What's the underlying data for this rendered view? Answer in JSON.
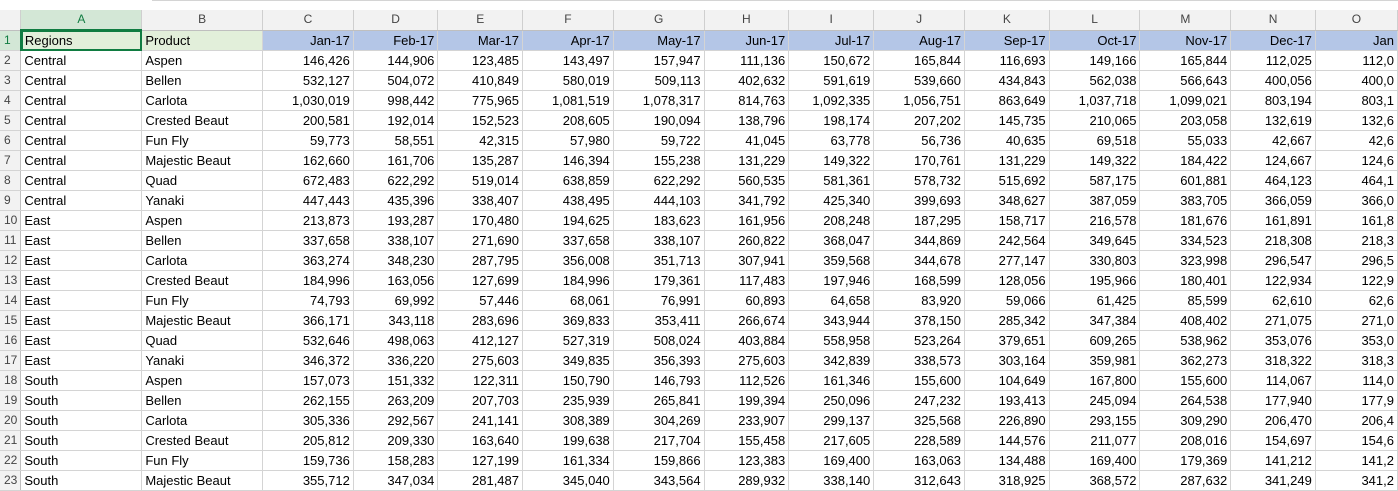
{
  "columns": [
    "A",
    "B",
    "C",
    "D",
    "E",
    "F",
    "G",
    "H",
    "I",
    "J",
    "K",
    "L",
    "M",
    "N",
    "O"
  ],
  "header_row": [
    "Regions",
    "Product",
    "Jan-17",
    "Feb-17",
    "Mar-17",
    "Apr-17",
    "May-17",
    "Jun-17",
    "Jul-17",
    "Aug-17",
    "Sep-17",
    "Oct-17",
    "Nov-17",
    "Dec-17",
    "Jan"
  ],
  "active_cell": "A1",
  "rows": [
    {
      "n": "2",
      "cells": [
        "Central",
        "Aspen",
        "146,426",
        "144,906",
        "123,485",
        "143,497",
        "157,947",
        "111,136",
        "150,672",
        "165,844",
        "116,693",
        "149,166",
        "165,844",
        "112,025",
        "112,0"
      ]
    },
    {
      "n": "3",
      "cells": [
        "Central",
        "Bellen",
        "532,127",
        "504,072",
        "410,849",
        "580,019",
        "509,113",
        "402,632",
        "591,619",
        "539,660",
        "434,843",
        "562,038",
        "566,643",
        "400,056",
        "400,0"
      ]
    },
    {
      "n": "4",
      "cells": [
        "Central",
        "Carlota",
        "1,030,019",
        "998,442",
        "775,965",
        "1,081,519",
        "1,078,317",
        "814,763",
        "1,092,335",
        "1,056,751",
        "863,649",
        "1,037,718",
        "1,099,021",
        "803,194",
        "803,1"
      ]
    },
    {
      "n": "5",
      "cells": [
        "Central",
        "Crested Beaut",
        "200,581",
        "192,014",
        "152,523",
        "208,605",
        "190,094",
        "138,796",
        "198,174",
        "207,202",
        "145,735",
        "210,065",
        "203,058",
        "132,619",
        "132,6"
      ]
    },
    {
      "n": "6",
      "cells": [
        "Central",
        "Fun Fly",
        "59,773",
        "58,551",
        "42,315",
        "57,980",
        "59,722",
        "41,045",
        "63,778",
        "56,736",
        "40,635",
        "69,518",
        "55,033",
        "42,667",
        "42,6"
      ]
    },
    {
      "n": "7",
      "cells": [
        "Central",
        "Majestic Beaut",
        "162,660",
        "161,706",
        "135,287",
        "146,394",
        "155,238",
        "131,229",
        "149,322",
        "170,761",
        "131,229",
        "149,322",
        "184,422",
        "124,667",
        "124,6"
      ]
    },
    {
      "n": "8",
      "cells": [
        "Central",
        "Quad",
        "672,483",
        "622,292",
        "519,014",
        "638,859",
        "622,292",
        "560,535",
        "581,361",
        "578,732",
        "515,692",
        "587,175",
        "601,881",
        "464,123",
        "464,1"
      ]
    },
    {
      "n": "9",
      "cells": [
        "Central",
        "Yanaki",
        "447,443",
        "435,396",
        "338,407",
        "438,495",
        "444,103",
        "341,792",
        "425,340",
        "399,693",
        "348,627",
        "387,059",
        "383,705",
        "366,059",
        "366,0"
      ]
    },
    {
      "n": "10",
      "cells": [
        "East",
        "Aspen",
        "213,873",
        "193,287",
        "170,480",
        "194,625",
        "183,623",
        "161,956",
        "208,248",
        "187,295",
        "158,717",
        "216,578",
        "181,676",
        "161,891",
        "161,8"
      ]
    },
    {
      "n": "11",
      "cells": [
        "East",
        "Bellen",
        "337,658",
        "338,107",
        "271,690",
        "337,658",
        "338,107",
        "260,822",
        "368,047",
        "344,869",
        "242,564",
        "349,645",
        "334,523",
        "218,308",
        "218,3"
      ]
    },
    {
      "n": "12",
      "cells": [
        "East",
        "Carlota",
        "363,274",
        "348,230",
        "287,795",
        "356,008",
        "351,713",
        "307,941",
        "359,568",
        "344,678",
        "277,147",
        "330,803",
        "323,998",
        "296,547",
        "296,5"
      ]
    },
    {
      "n": "13",
      "cells": [
        "East",
        "Crested Beaut",
        "184,996",
        "163,056",
        "127,699",
        "184,996",
        "179,361",
        "117,483",
        "197,946",
        "168,599",
        "128,056",
        "195,966",
        "180,401",
        "122,934",
        "122,9"
      ]
    },
    {
      "n": "14",
      "cells": [
        "East",
        "Fun Fly",
        "74,793",
        "69,992",
        "57,446",
        "68,061",
        "76,991",
        "60,893",
        "64,658",
        "83,920",
        "59,066",
        "61,425",
        "85,599",
        "62,610",
        "62,6"
      ]
    },
    {
      "n": "15",
      "cells": [
        "East",
        "Majestic Beaut",
        "366,171",
        "343,118",
        "283,696",
        "369,833",
        "353,411",
        "266,674",
        "343,944",
        "378,150",
        "285,342",
        "347,384",
        "408,402",
        "271,075",
        "271,0"
      ]
    },
    {
      "n": "16",
      "cells": [
        "East",
        "Quad",
        "532,646",
        "498,063",
        "412,127",
        "527,319",
        "508,024",
        "403,884",
        "558,958",
        "523,264",
        "379,651",
        "609,265",
        "538,962",
        "353,076",
        "353,0"
      ]
    },
    {
      "n": "17",
      "cells": [
        "East",
        "Yanaki",
        "346,372",
        "336,220",
        "275,603",
        "349,835",
        "356,393",
        "275,603",
        "342,839",
        "338,573",
        "303,164",
        "359,981",
        "362,273",
        "318,322",
        "318,3"
      ]
    },
    {
      "n": "18",
      "cells": [
        "South",
        "Aspen",
        "157,073",
        "151,332",
        "122,311",
        "150,790",
        "146,793",
        "112,526",
        "161,346",
        "155,600",
        "104,649",
        "167,800",
        "155,600",
        "114,067",
        "114,0"
      ]
    },
    {
      "n": "19",
      "cells": [
        "South",
        "Bellen",
        "262,155",
        "263,209",
        "207,703",
        "235,939",
        "265,841",
        "199,394",
        "250,096",
        "247,232",
        "193,413",
        "245,094",
        "264,538",
        "177,940",
        "177,9"
      ]
    },
    {
      "n": "20",
      "cells": [
        "South",
        "Carlota",
        "305,336",
        "292,567",
        "241,141",
        "308,389",
        "304,269",
        "233,907",
        "299,137",
        "325,568",
        "226,890",
        "293,155",
        "309,290",
        "206,470",
        "206,4"
      ]
    },
    {
      "n": "21",
      "cells": [
        "South",
        "Crested Beaut",
        "205,812",
        "209,330",
        "163,640",
        "199,638",
        "217,704",
        "155,458",
        "217,605",
        "228,589",
        "144,576",
        "211,077",
        "208,016",
        "154,697",
        "154,6"
      ]
    },
    {
      "n": "22",
      "cells": [
        "South",
        "Fun Fly",
        "159,736",
        "158,283",
        "127,199",
        "161,334",
        "159,866",
        "123,383",
        "169,400",
        "163,063",
        "134,488",
        "169,400",
        "179,369",
        "141,212",
        "141,2"
      ]
    },
    {
      "n": "23",
      "cells": [
        "South",
        "Majestic Beaut",
        "355,712",
        "347,034",
        "281,487",
        "345,040",
        "343,564",
        "289,932",
        "338,140",
        "312,643",
        "318,925",
        "368,572",
        "287,632",
        "341,249",
        "341,2"
      ]
    }
  ]
}
